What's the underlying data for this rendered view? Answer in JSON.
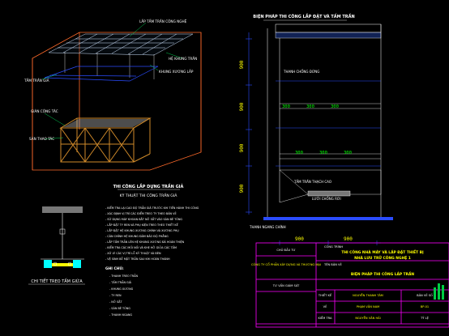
{
  "colors": {
    "background": "#000000",
    "frame": "#ff00ff",
    "blue_line": "#2a4cff",
    "grid": "#00ff00",
    "label": "#ffffff",
    "accent_yellow": "#ffff00",
    "accent_orange": "#ff8800",
    "accent_green": "#00ff66",
    "cyan": "#00ffff"
  },
  "iso_view": {
    "labels": {
      "top_tray": "LẮP TẤM TRẦN CÔNG NGHỆ",
      "frame_right": "HỆ KHUNG TRẦN",
      "clip_right": "KHUNG XƯƠNG LẮP",
      "left_label": "TẤM TRẦN GIẢ",
      "scaffold_left": "GIÀN CÔNG TÁC",
      "platform_left": "SÀN THAO TÁC"
    },
    "title": "THI CÔNG LẮP DỰNG TRẦN GIẢ",
    "subtitle": "KỸ THUẬT THI CÔNG TRẦN GIẢ"
  },
  "section": {
    "title": "BIỆN PHÁP THI CÔNG LẮP ĐẶT VÀ TẤM TRẦN",
    "dims_left": [
      "900",
      "900",
      "900",
      "900"
    ],
    "dims_span": [
      "300",
      "300",
      "300"
    ],
    "dims_span2": [
      "300",
      "300",
      "300"
    ],
    "dims_bottom": [
      "900",
      "900"
    ],
    "tags": [
      "THANH CHỐNG ĐỨNG",
      "TẤM TRẦN THẠCH CAO",
      "LƯỚI CHỐNG RƠI",
      "THANH NGANG CHÍNH"
    ]
  },
  "detail": {
    "caption": "CHI TIẾT TREO TẤM GIỮA"
  },
  "notes": {
    "lines": [
      "- KIỂM TRA LẠI CAO ĐỘ TRẦN GIẢ TRƯỚC KHI TIẾN HÀNH THI CÔNG",
      "- XÁC ĐỊNH VỊ TRÍ CÁC ĐIỂM TREO TY THEO BẢN VẼ",
      "- SỬ DỤNG MÁY KHOAN BẮT NỞ SẮT VÀO SÀN BÊ TÔNG",
      "- LẮP ĐẶT TY REN VÀ PHỤ KIỆN TREO THEO THIẾT KẾ",
      "- LẮP ĐẶT HỆ KHUNG XƯƠNG CHÍNH VÀ XƯƠNG PHỤ",
      "- CÂN CHỈNH HỆ KHUNG ĐẢM BẢO ĐỘ PHẲNG",
      "- LẮP TẤM TRẦN LÊN HỆ KHUNG XƯƠNG ĐÃ HOÀN THIỆN",
      "- KIỂM TRA CÁC MỐI NỐI VÀ KHE HỞ GIỮA CÁC TẤM",
      "- XỬ LÝ CÁC VỊ TRÍ LỖ KỸ THUẬT VÀ ĐÈN",
      "- VỆ SINH BỀ MẶT TRẦN SAU KHI HOÀN THÀNH"
    ],
    "legend_title": "GHI CHÚ:",
    "legend": [
      "- THANH TREO TRẦN",
      "- TẤM TRẦN GIẢ",
      "- KHUNG XƯƠNG",
      "- TY REN",
      "- NỞ SẮT",
      "- SÀN BÊ TÔNG",
      "- THANH NGANG"
    ]
  },
  "title_block": {
    "client_label": "CHỦ ĐẦU TƯ",
    "company": "CÔNG TY CỔ PHẦN XÂY DỰNG VÀ THƯƠNG MẠI",
    "consultant": "TƯ VẤN GIÁM SÁT",
    "project_label": "CÔNG TRÌNH",
    "project_title": "THI CÔNG NHÀ MÁY VÀ LẮP ĐẶT THIẾT BỊ",
    "project_sub": "NHÀ LƯU TRỮ CÔNG NGHỆ 1",
    "drawing_label": "TÊN BẢN VẼ",
    "drawing_title": "BIỆN PHÁP THI CÔNG LẮP TRẦN",
    "rows": [
      {
        "role": "THIẾT KẾ",
        "name": "NGUYỄN THANH TÂM"
      },
      {
        "role": "VẼ",
        "name": "PHẠM VĂN NAM"
      },
      {
        "role": "KIỂM TRA",
        "name": "NGUYỄN VĂN HẢI"
      }
    ],
    "sheet_label": "BẢN VẼ SỐ",
    "sheet_no": "BP-01",
    "scale_label": "TỶ LỆ",
    "scale": "1:50"
  }
}
